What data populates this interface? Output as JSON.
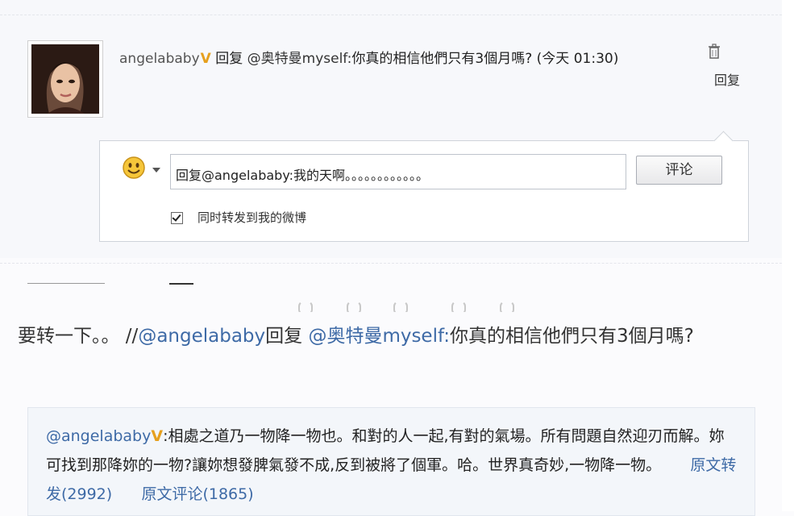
{
  "reply": {
    "username": "angelababy",
    "vip_mark": "V",
    "reply_word": "回复",
    "mention": "@奥特曼myself:",
    "message": "你真的相信他們只有3個月嗎?",
    "time": "(今天  01:30)",
    "reply_link": "回复"
  },
  "comment_form": {
    "input_value": "回复@angelababy:我的天啊。。。。。。。。。。。。",
    "submit_label": "评论",
    "repost_label": "同时转发到我的微博",
    "repost_checked": true
  },
  "repost": {
    "prefix": "要转一下。。  //",
    "mention": "@angelababy",
    "reply_word": "回复  ",
    "target": "@奥特曼myself:",
    "message": "你真的相信他們只有3個月嗎?"
  },
  "original_post": {
    "author": "@angelababy",
    "vip_mark": "V",
    "text": ":相處之道乃一物降一物也。和對的人一起,有對的氣場。所有問題自然迎刃而解。妳可找到那降妳的一物?讓妳想發脾氣發不成,反到被將了個軍。哈。世界真奇妙,一物降一物。",
    "repost_link": "原文转发(2992)",
    "comment_link": "原文评论(1865)"
  },
  "icons": {
    "avatar": "user-avatar-photo",
    "trash": "trash-icon",
    "emoticon": "smiley-icon",
    "dropdown": "chevron-down-icon"
  },
  "colors": {
    "link": "#3e6aa6",
    "vip": "#e6a01e"
  }
}
